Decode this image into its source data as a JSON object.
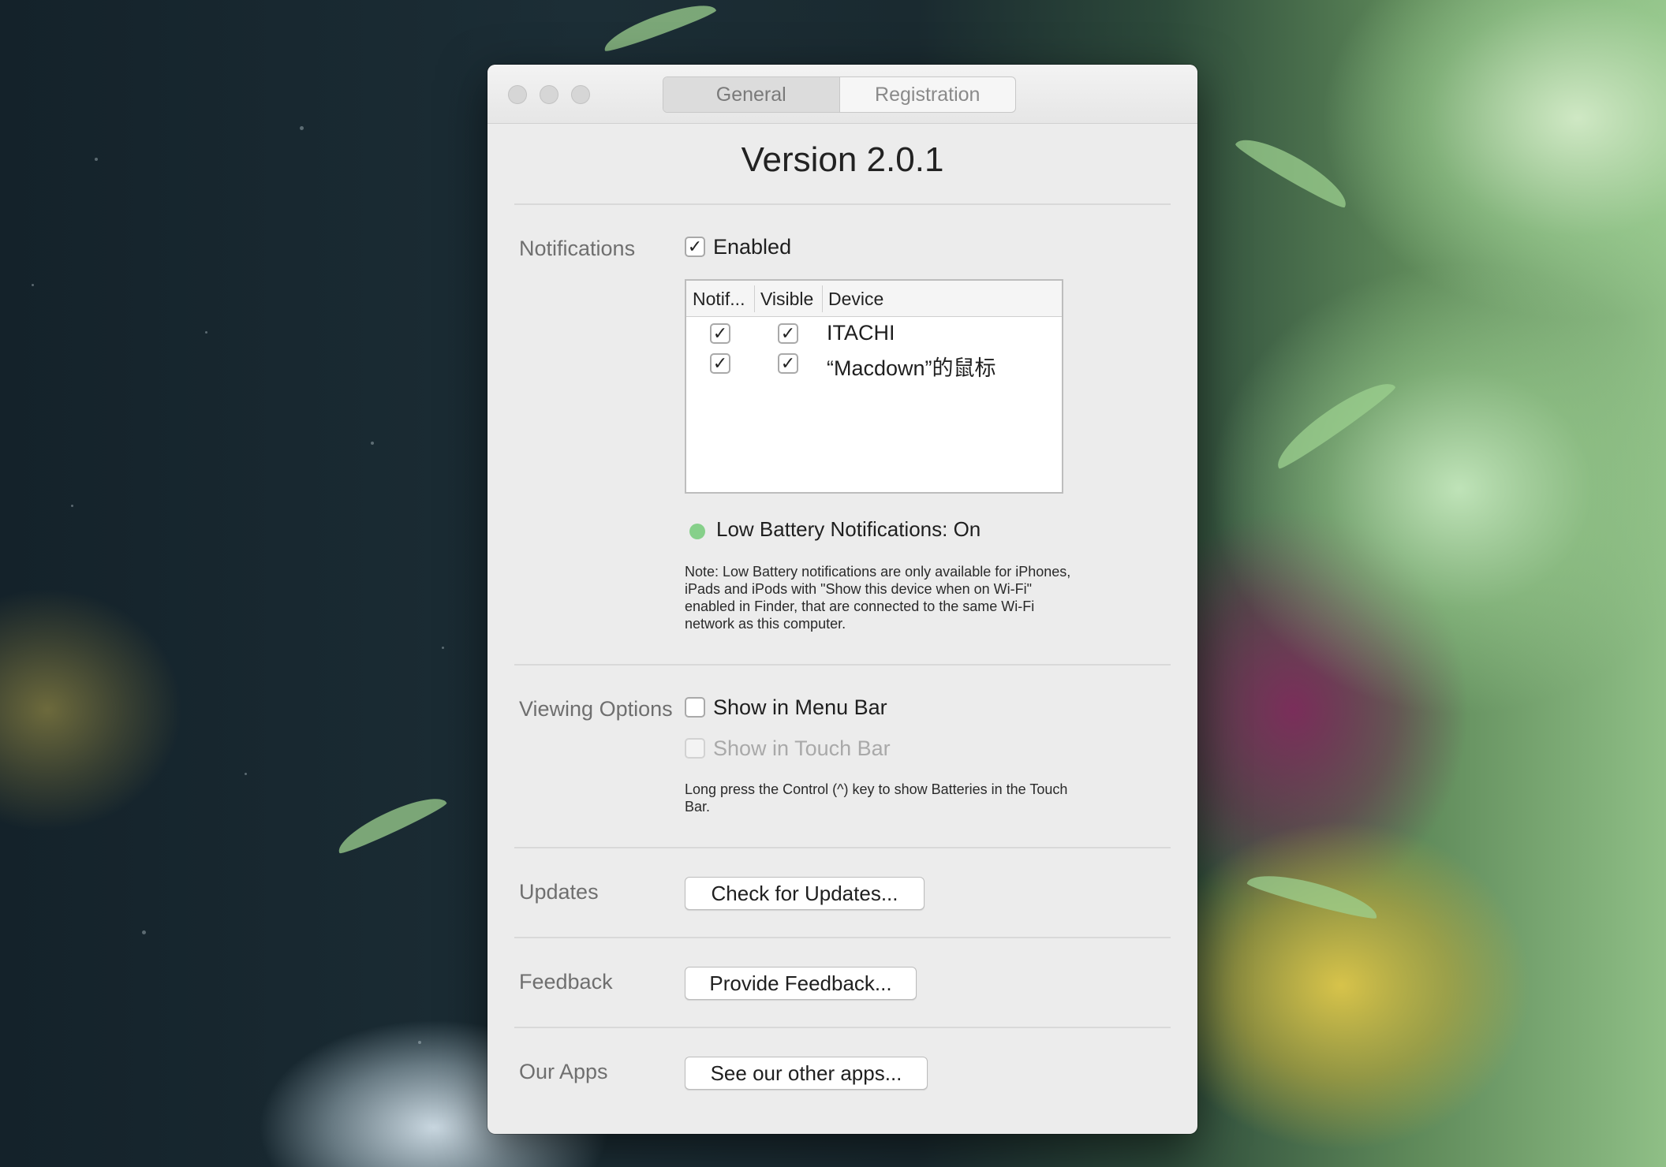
{
  "window": {
    "tabs": [
      {
        "label": "General",
        "selected": true
      },
      {
        "label": "Registration",
        "selected": false
      }
    ],
    "version_title": "Version 2.0.1"
  },
  "notifications": {
    "section_label": "Notifications",
    "enabled_label": "Enabled",
    "enabled_checked": true,
    "table": {
      "columns": [
        "Notif...",
        "Visible",
        "Device"
      ],
      "rows": [
        {
          "notify": true,
          "visible": true,
          "device": "ITACHI"
        },
        {
          "notify": true,
          "visible": true,
          "device": "“Macdown”的鼠标"
        }
      ]
    },
    "low_battery_status": "Low Battery Notifications: On",
    "status_color": "#86d08a",
    "note": "Note: Low Battery notifications are only available for iPhones, iPads and iPods with \"Show this device when on Wi-Fi\" enabled in Finder, that are connected to the same Wi-Fi network as this computer."
  },
  "viewing_options": {
    "section_label": "Viewing Options",
    "menu_bar_label": "Show in Menu Bar",
    "menu_bar_checked": false,
    "touch_bar_label": "Show in Touch Bar",
    "touch_bar_checked": false,
    "touch_bar_enabled": false,
    "note": "Long press the Control (^) key to show Batteries in the Touch Bar."
  },
  "updates": {
    "section_label": "Updates",
    "button_label": "Check for Updates..."
  },
  "feedback": {
    "section_label": "Feedback",
    "button_label": "Provide Feedback..."
  },
  "our_apps": {
    "section_label": "Our Apps",
    "button_label": "See our other apps..."
  },
  "icons": {
    "checkmark": "checkmark-icon",
    "window_controls": [
      "close-button",
      "minimize-button",
      "zoom-button"
    ]
  }
}
